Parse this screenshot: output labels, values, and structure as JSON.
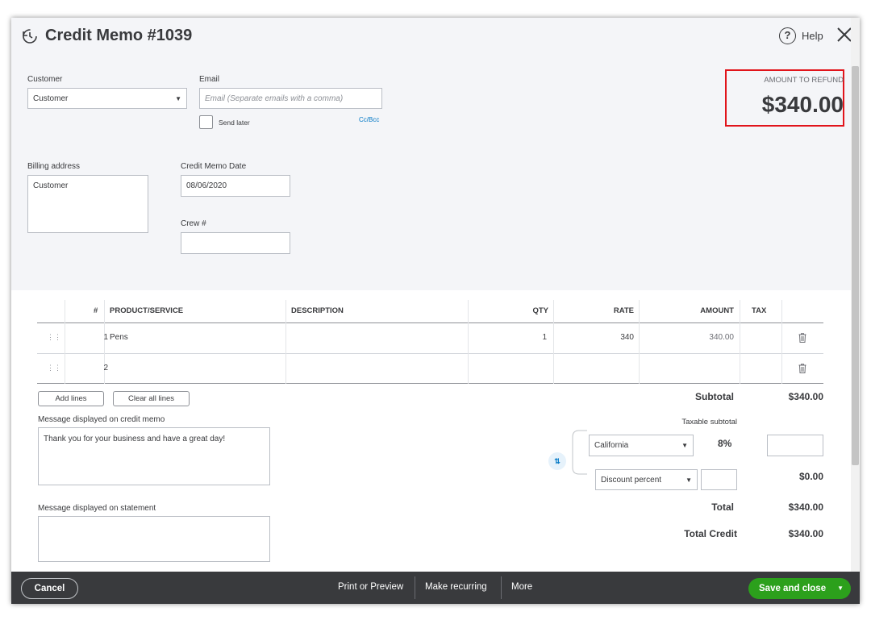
{
  "header": {
    "title": "Credit Memo #1039",
    "help_label": "Help"
  },
  "refund": {
    "label": "AMOUNT TO REFUND",
    "amount": "$340.00"
  },
  "form": {
    "customer_label": "Customer",
    "customer_value": "Customer",
    "email_label": "Email",
    "email_placeholder": "Email (Separate emails with a comma)",
    "send_later_label": "Send later",
    "cc_bcc_label": "Cc/Bcc",
    "billing_address_label": "Billing address",
    "billing_address_value": "Customer",
    "credit_memo_date_label": "Credit Memo Date",
    "credit_memo_date_value": "08/06/2020",
    "crew_label": "Crew #",
    "crew_value": ""
  },
  "table": {
    "headers": {
      "num": "#",
      "product": "PRODUCT/SERVICE",
      "description": "DESCRIPTION",
      "qty": "QTY",
      "rate": "RATE",
      "amount": "AMOUNT",
      "tax": "TAX"
    },
    "rows": [
      {
        "num": "1",
        "product": "Pens",
        "description": "",
        "qty": "1",
        "rate": "340",
        "amount": "340.00"
      },
      {
        "num": "2",
        "product": "",
        "description": "",
        "qty": "",
        "rate": "",
        "amount": ""
      }
    ],
    "add_lines_label": "Add lines",
    "clear_lines_label": "Clear all lines"
  },
  "messages": {
    "credit_memo_label": "Message displayed on credit memo",
    "credit_memo_value": "Thank you for your business and have a great day!",
    "statement_label": "Message displayed on statement",
    "statement_value": ""
  },
  "summary": {
    "subtotal_label": "Subtotal",
    "subtotal_value": "$340.00",
    "taxable_subtotal_label": "Taxable subtotal",
    "tax_region": "California",
    "tax_rate": "8%",
    "discount_type": "Discount percent",
    "discount_value": "$0.00",
    "total_label": "Total",
    "total_value": "$340.00",
    "total_credit_label": "Total Credit",
    "total_credit_value": "$340.00"
  },
  "footer": {
    "cancel_label": "Cancel",
    "print_label": "Print or Preview",
    "recurring_label": "Make recurring",
    "more_label": "More",
    "save_label": "Save and close"
  },
  "colors": {
    "accent_green": "#2ca01c",
    "highlight_red": "#e1141b",
    "link_blue": "#0077c5",
    "footer_bg": "#393a3d"
  }
}
